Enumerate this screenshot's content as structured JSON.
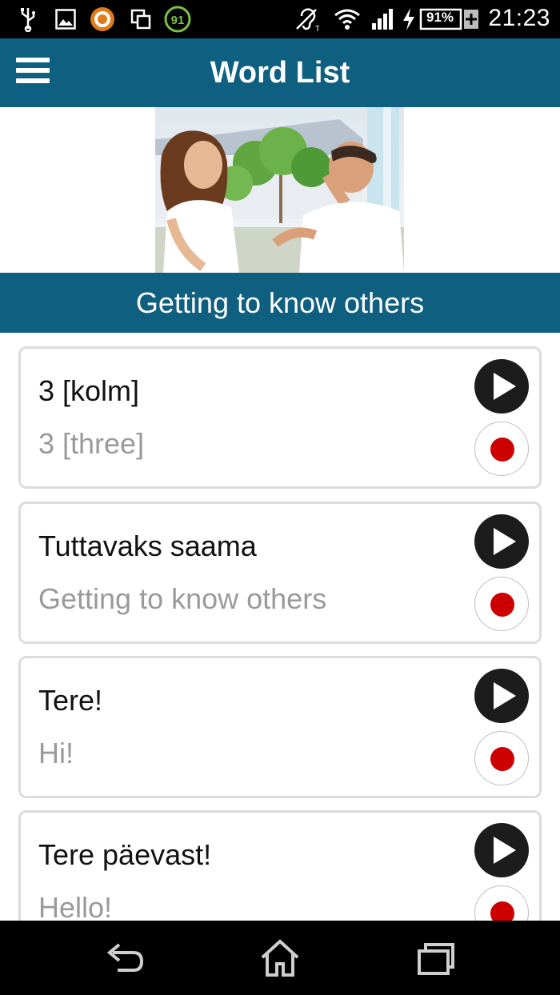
{
  "status_bar": {
    "battery_percent": "91%",
    "time": "21:23",
    "notification_badge": "91",
    "icons": [
      "usb-icon",
      "image-icon",
      "app-circle-icon",
      "overlap-icon",
      "badge-91-icon",
      "hearing-aid-icon",
      "wifi-icon",
      "signal-icon",
      "charging-icon",
      "battery-icon"
    ]
  },
  "app_bar": {
    "title": "Word List",
    "menu_icon": "hamburger-menu-icon"
  },
  "hero": {
    "image": "two people talking photo"
  },
  "section": {
    "title": "Getting to know others"
  },
  "words": [
    {
      "primary": "3 [kolm]",
      "secondary": "3 [three]"
    },
    {
      "primary": "Tuttavaks saama",
      "secondary": "Getting to know others"
    },
    {
      "primary": "Tere!",
      "secondary": "Hi!"
    },
    {
      "primary": "Tere päevast!",
      "secondary": "Hello!"
    }
  ],
  "nav_bar": {
    "icons": [
      "back-icon",
      "home-icon",
      "recent-apps-icon"
    ]
  },
  "colors": {
    "accent": "#0f5f80",
    "record": "#cc0000",
    "play": "#1c1c1c",
    "secondary_text": "#9a9a9a",
    "card_border": "#dcdcdc"
  }
}
